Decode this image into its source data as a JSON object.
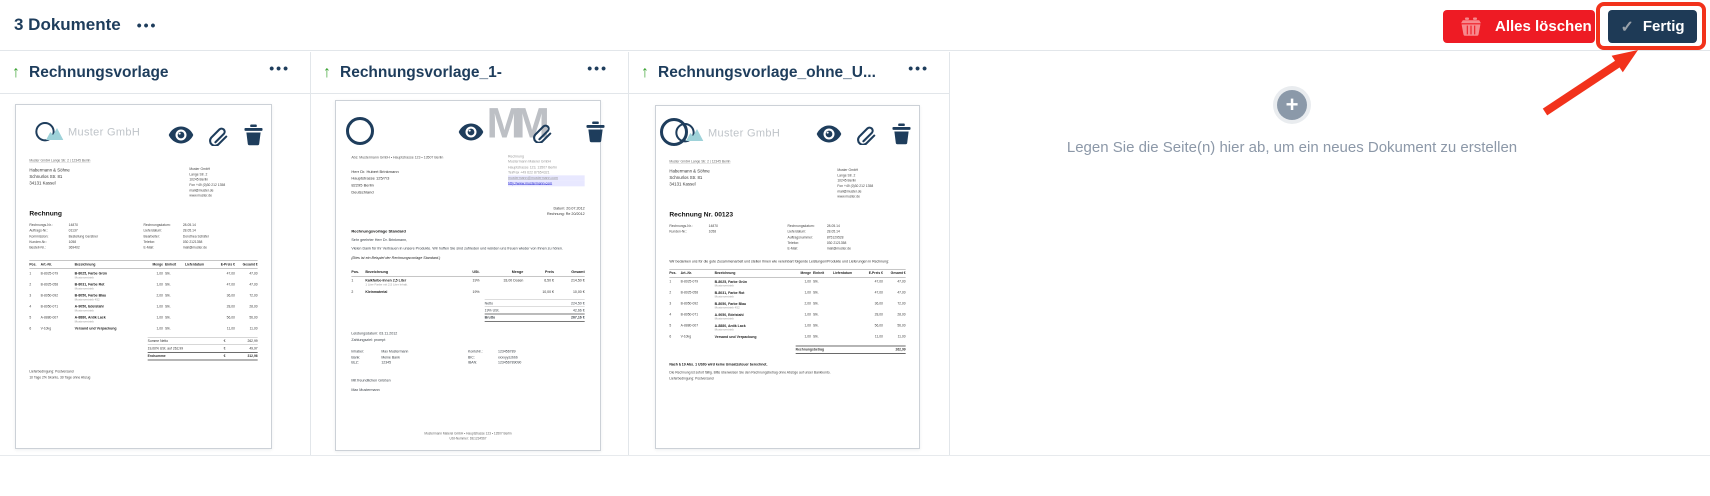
{
  "icons": {
    "more": "•••",
    "up_arrow": "↑",
    "check": "✓",
    "plus": "+"
  },
  "topbar": {
    "title": "3 Dokumente"
  },
  "toolbar": {
    "delete_all": "Alles löschen",
    "done": "Fertig"
  },
  "dropzone": {
    "hint": "Legen Sie die Seite(n) hier ab, um ein neues Dokument zu erstellen"
  },
  "colors": {
    "navy": "#1e3d5c",
    "green": "#3ca334",
    "red": "#ee1b24",
    "annotation_red": "#f2321b",
    "muted": "#8c98a8"
  },
  "cards": [
    {
      "title": "Rechnungsvorlage",
      "doc": {
        "logo": "Muster GmbH",
        "sender": "Muster GmbH Lange Str. 2 | 12345 Berlin",
        "recipient": [
          "Habermann & Söhne",
          "Schnurlos Str. 81",
          "34131 Kassel"
        ],
        "company": [
          "Muster GmbH",
          "Lange Str. 2",
          "10245 Berlin",
          "Fon +49 (0)30 212 1358",
          "mail@muster.de",
          "www.muster.de"
        ],
        "heading": "Rechnung",
        "meta_left": [
          [
            "Rechnungs-Nr.:",
            "14870"
          ],
          [
            "Auftrags-Nr.:",
            "01137"
          ],
          [
            "Kommission:",
            "Bestellung Gerstner"
          ],
          [
            "Kunden-Nr.:",
            "1058"
          ],
          [
            "Bestell-Nr.:",
            "369402"
          ]
        ],
        "meta_right": [
          [
            "Rechnungsdatum:",
            "28.05.14"
          ],
          [
            "Lieferdatum:",
            "28.05.14"
          ],
          [
            "Bearbeiter:",
            "Dorothea Schäfer"
          ],
          [
            "Telefon:",
            "030 2121358"
          ],
          [
            "E-Mail:",
            "mail@muster.de"
          ]
        ],
        "table_headers": [
          "Pos.",
          "Art.-Nr.",
          "Bezeichnung",
          "Menge",
          "Einheit",
          "Lieferdatum",
          "E-Preis €",
          "Gesamt €"
        ],
        "items": [
          {
            "pos": "1",
            "art": "B-8025-079",
            "name": "B-8025, Farbe Grün",
            "sub": "Mustervertrieb",
            "qty": "1,00",
            "unit": "Stk.",
            "lief": "",
            "price": "47,00",
            "total": "47,00"
          },
          {
            "pos": "2",
            "art": "B-8025-058",
            "name": "B-8031, Farbe Rot",
            "sub": "Mustervertrieb",
            "qty": "1,00",
            "unit": "Stk.",
            "lief": "",
            "price": "47,00",
            "total": "47,00"
          },
          {
            "pos": "3",
            "art": "B-8050-092",
            "name": "B-8050, Farbe Blau",
            "sub": "Mustervertrieb 452",
            "qty": "2,00",
            "unit": "Stk.",
            "lief": "",
            "price": "36,00",
            "total": "72,00"
          },
          {
            "pos": "4",
            "art": "B-8050-071",
            "name": "A-9050, Edelstahl",
            "sub": "Mustervertrieb",
            "qty": "1,00",
            "unit": "Stk.",
            "lief": "",
            "price": "28,00",
            "total": "28,00"
          },
          {
            "pos": "5",
            "art": "A-8880-007",
            "name": "A-8880, Antik Lack",
            "sub": "Mustervertrieb",
            "qty": "1,00",
            "unit": "Stk.",
            "lief": "",
            "price": "56,00",
            "total": "56,00"
          },
          {
            "pos": "6",
            "art": "V-10kg",
            "name": "Versand und Verpackung",
            "sub": "",
            "qty": "1,00",
            "unit": "Stk.",
            "lief": "",
            "price": "11,00",
            "total": "11,00"
          }
        ],
        "totals": [
          [
            "Summe Netto",
            "€",
            "262,99"
          ],
          [
            "19,00% USt. auf 262,99",
            "€",
            "49,97"
          ],
          [
            "Endsumme",
            "€",
            "312,96"
          ]
        ],
        "footer": [
          "Lieferbedingung: Postversand",
          "10 Tage 2% Skonto, 30 Tage ohne Abzug"
        ]
      }
    },
    {
      "title": "Rechnungsvorlage_1-",
      "doc": {
        "letterhead": "MM",
        "sender": "Abs: Mustermann GmbH • Hauptstrasse 123 • 13507 Berlin",
        "recipient": [
          "Herr Dr. Hubert Brinkmann",
          "Hauptstrasse 125/7/3",
          "82295 Berlin",
          "Deutschland"
        ],
        "company": [
          "Rechnung",
          "Mustermann Malerei GmbH",
          "Hauptstrasse 123, 13507 Berlin",
          "Tel/Fax +49 622 87654321"
        ],
        "links": [
          "mustermann@mustermann.com",
          "http://www.mustermann.com"
        ],
        "dates": [
          "Datum: 20.07.2012",
          "Rechnung: Re 20/2012"
        ],
        "subject": "Rechnungsvorlage Standard",
        "salutation": "Sehr geehrter Herr Dr. Brinkmann,",
        "body": "Vielen Dank für Ihr Vertrauen in unsere Produkte. Wir hoffen Sie sind zufrieden und würden uns freuen wieder von Ihnen zu hören.",
        "note": "(Dies ist ein Beispiel der Rechnungsvorlage Standard.)",
        "table_headers": [
          "Pos.",
          "Bezeichnung",
          "USt.",
          "Menge",
          "Preis",
          "Gesamt"
        ],
        "items": [
          {
            "pos": "1",
            "name": "Kalkfarbe-Innen 2,5 Liter",
            "sub": "1 Liter Farbe mit 2,5 Liter Inhalt.",
            "ust": "19%",
            "qty": "33,00 Dosen",
            "price": "6,50 €",
            "total": "214,50 €"
          },
          {
            "pos": "2",
            "name": "Kleinmaterial",
            "sub": "",
            "ust": "19%",
            "qty": "",
            "price": "10,00 €",
            "total": "10,00 €"
          }
        ],
        "totals": [
          [
            "Netto",
            "224,50 €"
          ],
          [
            "19% USt.",
            "42,66 €"
          ],
          [
            "Brutto",
            "267,16 €"
          ]
        ],
        "delivery": [
          "Leistungsdatum: 03.11.2012",
          "Zahlungsziel: prompt"
        ],
        "bank_left": [
          [
            "Inhaber:",
            "Max Mustermann"
          ],
          [
            "Bank:",
            "Meine Bank"
          ],
          [
            "BLZ:",
            "12345"
          ]
        ],
        "bank_right": [
          [
            "KontoNr.:",
            "123456789"
          ],
          [
            "BIC:",
            "xxxxyyzzbbb"
          ],
          [
            "IBAN:",
            "123456789090"
          ]
        ],
        "closing": [
          "Mit freundlichen Grüßen",
          "Max Mustermann"
        ],
        "footer": [
          "Mustermann Malerei GmbH • Hauptstrasse 123 • 13507 Berlin",
          "USt-Nummer: DE1234567"
        ]
      }
    },
    {
      "title": "Rechnungsvorlage_ohne_U...",
      "doc": {
        "logo": "Muster GmbH",
        "sender": "Muster GmbH Lange Str. 2 | 12345 Berlin",
        "recipient": [
          "Habermann & Söhne",
          "Schnurlos Str. 81",
          "34131 Kassel"
        ],
        "company": [
          "Muster GmbH",
          "Lange Str. 2",
          "10245 Berlin",
          "Fon +49 (0)30 212 1358",
          "mail@muster.de",
          "www.muster.de"
        ],
        "heading": "Rechnung Nr. 00123",
        "meta_left": [
          [
            "Rechnungs-Nr.:",
            "14870"
          ],
          [
            "Kunden-Nr.:",
            "1058"
          ]
        ],
        "meta_right": [
          [
            "Rechnungsdatum:",
            "28.05.14"
          ],
          [
            "Lieferdatum:",
            "28.05.14"
          ],
          [
            "Auftragsnummer:",
            "875129528"
          ],
          [
            "Telefon:",
            "030 2121358"
          ],
          [
            "E-Mail:",
            "mail@muster.de"
          ]
        ],
        "intro": "Wir bedanken uns für die gute Zusammenarbeit und stellen Ihnen wie vereinbart folgende Leistungen/Produkte und Lieferungen in Rechnung:",
        "table_headers": [
          "Pos.",
          "Art.-Nr.",
          "Bezeichnung",
          "Menge",
          "Einheit",
          "Lieferdatum",
          "E-Preis €",
          "Gesamt €"
        ],
        "items": [
          {
            "pos": "1",
            "art": "B-8025-079",
            "name": "B-8025, Farbe Grün",
            "sub": "Mustervertrieb",
            "qty": "1,00",
            "unit": "Stk.",
            "lief": "",
            "price": "47,00",
            "total": "47,00"
          },
          {
            "pos": "2",
            "art": "B-8025-058",
            "name": "B-8031, Farbe Rot",
            "sub": "Mustervertrieb",
            "qty": "1,00",
            "unit": "Stk.",
            "lief": "",
            "price": "47,00",
            "total": "47,00"
          },
          {
            "pos": "3",
            "art": "B-8050-092",
            "name": "B-8050, Farbe Blau",
            "sub": "Mustervertrieb 452",
            "qty": "2,00",
            "unit": "Stk.",
            "lief": "",
            "price": "36,00",
            "total": "72,00"
          },
          {
            "pos": "4",
            "art": "B-8050-071",
            "name": "A-9050, Edelstahl",
            "sub": "Mustervertrieb",
            "qty": "1,00",
            "unit": "Stk.",
            "lief": "",
            "price": "28,00",
            "total": "28,00"
          },
          {
            "pos": "5",
            "art": "A-8880-007",
            "name": "A-8880, Antik Lack",
            "sub": "Mustervertrieb",
            "qty": "1,00",
            "unit": "Stk.",
            "lief": "",
            "price": "56,00",
            "total": "56,00"
          },
          {
            "pos": "6",
            "art": "V-10kg",
            "name": "Versand und Verpackung",
            "sub": "",
            "qty": "1,00",
            "unit": "Stk.",
            "lief": "",
            "price": "11,00",
            "total": "11,00"
          }
        ],
        "totals": [
          [
            "Rechnungsbetrag",
            "",
            "262,99"
          ]
        ],
        "notes_bold": "Nach § 19 Abs. 1 UStG wird keine Umsatzsteuer berechnet.",
        "notes": [
          "Die Rechnung ist sofort fällig. Bitte überweisen Sie den Rechnungsbetrag ohne Abzüge auf unser Bankkonto.",
          "Lieferbedingung: Postversand"
        ]
      }
    }
  ]
}
